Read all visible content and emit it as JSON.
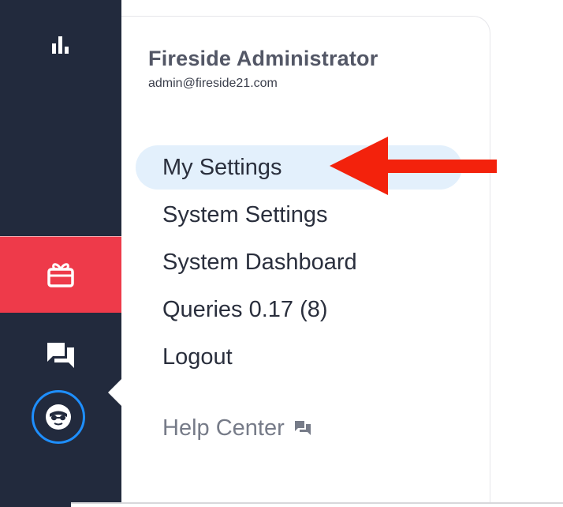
{
  "user": {
    "name": "Fireside Administrator",
    "email": "admin@fireside21.com"
  },
  "menu": {
    "items": [
      {
        "label": "My Settings",
        "highlighted": true
      },
      {
        "label": "System Settings"
      },
      {
        "label": "System Dashboard"
      },
      {
        "label": "Queries 0.17 (8)"
      },
      {
        "label": "Logout"
      }
    ],
    "help_label": "Help Center"
  },
  "sidebar": {
    "icons": [
      "bar-chart-icon",
      "gift-icon",
      "chat-icon",
      "avatar-icon"
    ],
    "active_color": "#ee3a4a",
    "background": "#222a3d"
  },
  "annotation": {
    "arrow_color": "#f3220c",
    "points_to": "My Settings"
  }
}
